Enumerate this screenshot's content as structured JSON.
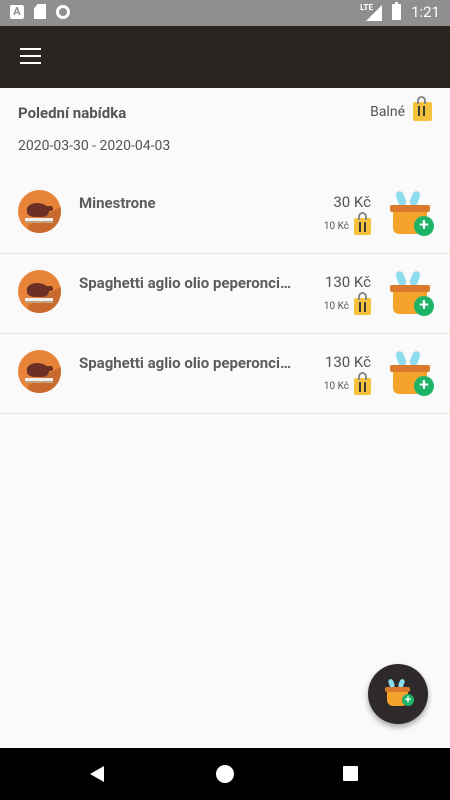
{
  "status_bar": {
    "time": "1:21",
    "network_label": "LTE",
    "icons": [
      "a-notification-icon",
      "sd-card-icon",
      "circle-notification-icon",
      "lte-signal-icon",
      "battery-icon"
    ]
  },
  "header": {
    "title": "Polední nabídka",
    "date_range": "2020-03-30 - 2020-04-03",
    "packaging_label": "Balné"
  },
  "menu": {
    "items": [
      {
        "name": "Minestrone",
        "price": "30 Kč",
        "packaging_fee": "10 Kč"
      },
      {
        "name": "Spaghetti aglio olio peperoncino",
        "price": "130 Kč",
        "packaging_fee": "10 Kč"
      },
      {
        "name": "Spaghetti aglio olio peperoncino",
        "price": "130 Kč",
        "packaging_fee": "10 Kč"
      }
    ]
  },
  "colors": {
    "app_bar": "#2b2522",
    "background": "#fafafa",
    "divider": "#e3e5d6",
    "basket_orange": "#f4a32b",
    "add_green": "#1fb36a",
    "bag_yellow": "#f5c33b"
  }
}
